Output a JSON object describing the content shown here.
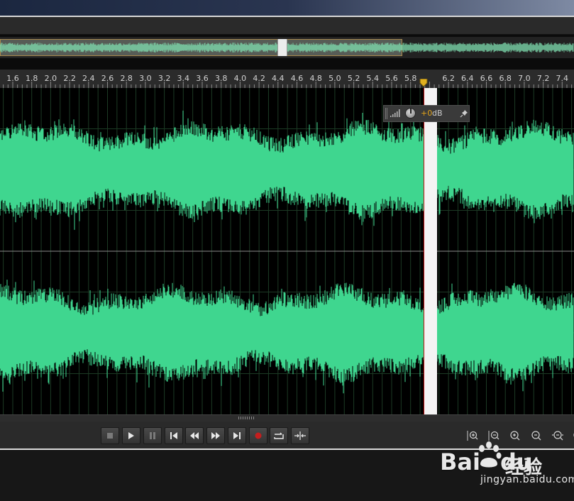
{
  "ruler": {
    "labels": [
      "1.6",
      "1.8",
      "2.0",
      "2.2",
      "2.4",
      "2.6",
      "2.8",
      "3.0",
      "3.2",
      "3.4",
      "3.6",
      "3.8",
      "4.0",
      "4.2",
      "4.4",
      "4.6",
      "4.8",
      "5.0",
      "5.2",
      "5.4",
      "5.6",
      "5.8",
      "6.2",
      "6.4",
      "6.6",
      "6.8",
      "7.0",
      "7.2",
      "7.4"
    ],
    "units": "seconds"
  },
  "playhead": {
    "time": 5.94
  },
  "selection": {
    "start": 5.94,
    "end": 6.08
  },
  "hud": {
    "volume_value": "+0",
    "volume_unit": "dB",
    "pin": "⊣"
  },
  "transport": {
    "buttons": [
      "stop",
      "play",
      "pause",
      "move-to-previous",
      "rewind",
      "fast-forward",
      "move-to-next",
      "record",
      "loop",
      "skip-selection"
    ]
  },
  "zoom": {
    "buttons": [
      "zoom-in-amplitude",
      "zoom-out-amplitude",
      "zoom-in-time",
      "zoom-out-time",
      "zoom-out-full",
      "zoom-in-at-selection"
    ]
  },
  "watermark": {
    "logo": "Bai",
    "logo_tail": "du",
    "cn": "经验",
    "url": "jingyan.baidu.com"
  },
  "colors": {
    "waveform": "#3fd68f",
    "overview_wave": "#7fdfb0",
    "selection": "#f4f4f4",
    "playhead": "#c01010",
    "hud_value": "#e0a21a",
    "record": "#c41e1e"
  }
}
